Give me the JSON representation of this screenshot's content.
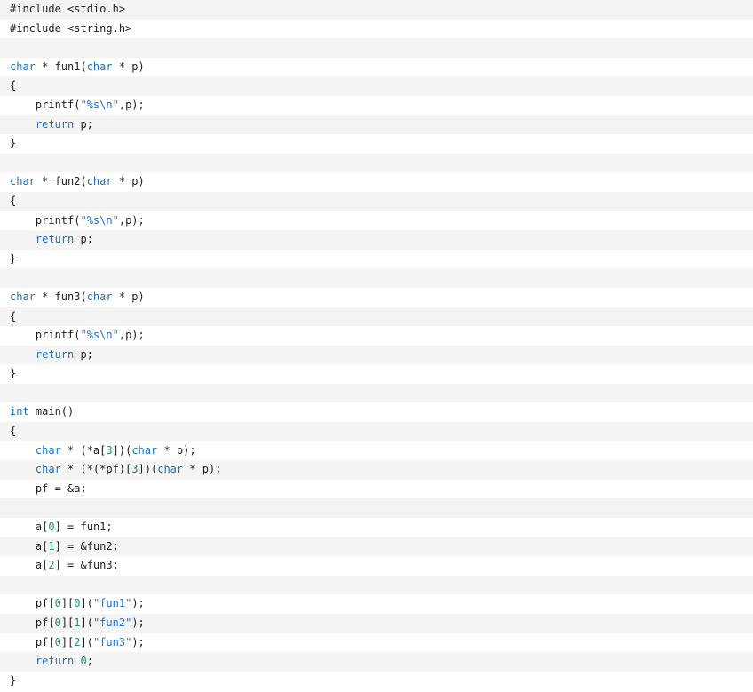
{
  "colors": {
    "keyword": "#1a73c8",
    "string": "#1a6fd0",
    "number": "#1b8f6a",
    "text": "#1f1f1f",
    "stripe": "#f4f4f4",
    "background": "#ffffff"
  },
  "lines": [
    {
      "shade": true,
      "tokens": [
        {
          "t": "#include <stdio.h>",
          "c": "tx"
        }
      ]
    },
    {
      "shade": false,
      "tokens": [
        {
          "t": "#include <string.h>",
          "c": "tx"
        }
      ]
    },
    {
      "shade": true,
      "tokens": []
    },
    {
      "shade": false,
      "tokens": [
        {
          "t": "char",
          "c": "kw"
        },
        {
          "t": " * fun1(",
          "c": "tx"
        },
        {
          "t": "char",
          "c": "kw"
        },
        {
          "t": " * p)",
          "c": "tx"
        }
      ]
    },
    {
      "shade": true,
      "tokens": [
        {
          "t": "{",
          "c": "tx"
        }
      ]
    },
    {
      "shade": false,
      "tokens": [
        {
          "t": "    printf(",
          "c": "tx"
        },
        {
          "t": "\"%s\\n\"",
          "c": "str"
        },
        {
          "t": ",p);",
          "c": "tx"
        }
      ]
    },
    {
      "shade": true,
      "tokens": [
        {
          "t": "    ",
          "c": "tx"
        },
        {
          "t": "return",
          "c": "kw"
        },
        {
          "t": " p;",
          "c": "tx"
        }
      ]
    },
    {
      "shade": false,
      "tokens": [
        {
          "t": "}",
          "c": "tx"
        }
      ]
    },
    {
      "shade": true,
      "tokens": []
    },
    {
      "shade": false,
      "tokens": [
        {
          "t": "char",
          "c": "kw"
        },
        {
          "t": " * fun2(",
          "c": "tx"
        },
        {
          "t": "char",
          "c": "kw"
        },
        {
          "t": " * p)",
          "c": "tx"
        }
      ]
    },
    {
      "shade": true,
      "tokens": [
        {
          "t": "{",
          "c": "tx"
        }
      ]
    },
    {
      "shade": false,
      "tokens": [
        {
          "t": "    printf(",
          "c": "tx"
        },
        {
          "t": "\"%s\\n\"",
          "c": "str"
        },
        {
          "t": ",p);",
          "c": "tx"
        }
      ]
    },
    {
      "shade": true,
      "tokens": [
        {
          "t": "    ",
          "c": "tx"
        },
        {
          "t": "return",
          "c": "kw"
        },
        {
          "t": " p;",
          "c": "tx"
        }
      ]
    },
    {
      "shade": false,
      "tokens": [
        {
          "t": "}",
          "c": "tx"
        }
      ]
    },
    {
      "shade": true,
      "tokens": []
    },
    {
      "shade": false,
      "tokens": [
        {
          "t": "char",
          "c": "kw"
        },
        {
          "t": " * fun3(",
          "c": "tx"
        },
        {
          "t": "char",
          "c": "kw"
        },
        {
          "t": " * p)",
          "c": "tx"
        }
      ]
    },
    {
      "shade": true,
      "tokens": [
        {
          "t": "{",
          "c": "tx"
        }
      ]
    },
    {
      "shade": false,
      "tokens": [
        {
          "t": "    printf(",
          "c": "tx"
        },
        {
          "t": "\"%s\\n\"",
          "c": "str"
        },
        {
          "t": ",p);",
          "c": "tx"
        }
      ]
    },
    {
      "shade": true,
      "tokens": [
        {
          "t": "    ",
          "c": "tx"
        },
        {
          "t": "return",
          "c": "kw"
        },
        {
          "t": " p;",
          "c": "tx"
        }
      ]
    },
    {
      "shade": false,
      "tokens": [
        {
          "t": "}",
          "c": "tx"
        }
      ]
    },
    {
      "shade": true,
      "tokens": []
    },
    {
      "shade": false,
      "tokens": [
        {
          "t": "int",
          "c": "kw"
        },
        {
          "t": " main()",
          "c": "tx"
        }
      ]
    },
    {
      "shade": true,
      "tokens": [
        {
          "t": "{",
          "c": "tx"
        }
      ]
    },
    {
      "shade": false,
      "tokens": [
        {
          "t": "    ",
          "c": "tx"
        },
        {
          "t": "char",
          "c": "kw"
        },
        {
          "t": " * (*a[",
          "c": "tx"
        },
        {
          "t": "3",
          "c": "num"
        },
        {
          "t": "])(",
          "c": "tx"
        },
        {
          "t": "char",
          "c": "kw"
        },
        {
          "t": " * p);",
          "c": "tx"
        }
      ]
    },
    {
      "shade": true,
      "tokens": [
        {
          "t": "    ",
          "c": "tx"
        },
        {
          "t": "char",
          "c": "kw"
        },
        {
          "t": " * (*(*pf)[",
          "c": "tx"
        },
        {
          "t": "3",
          "c": "num"
        },
        {
          "t": "])(",
          "c": "tx"
        },
        {
          "t": "char",
          "c": "kw"
        },
        {
          "t": " * p);",
          "c": "tx"
        }
      ]
    },
    {
      "shade": false,
      "tokens": [
        {
          "t": "    pf = &a;",
          "c": "tx"
        }
      ]
    },
    {
      "shade": true,
      "tokens": []
    },
    {
      "shade": false,
      "tokens": [
        {
          "t": "    a[",
          "c": "tx"
        },
        {
          "t": "0",
          "c": "num"
        },
        {
          "t": "] = fun1;",
          "c": "tx"
        }
      ]
    },
    {
      "shade": true,
      "tokens": [
        {
          "t": "    a[",
          "c": "tx"
        },
        {
          "t": "1",
          "c": "num"
        },
        {
          "t": "] = &fun2;",
          "c": "tx"
        }
      ]
    },
    {
      "shade": false,
      "tokens": [
        {
          "t": "    a[",
          "c": "tx"
        },
        {
          "t": "2",
          "c": "num"
        },
        {
          "t": "] = &fun3;",
          "c": "tx"
        }
      ]
    },
    {
      "shade": true,
      "tokens": []
    },
    {
      "shade": false,
      "tokens": [
        {
          "t": "    pf[",
          "c": "tx"
        },
        {
          "t": "0",
          "c": "num"
        },
        {
          "t": "][",
          "c": "tx"
        },
        {
          "t": "0",
          "c": "num"
        },
        {
          "t": "](",
          "c": "tx"
        },
        {
          "t": "\"fun1\"",
          "c": "str"
        },
        {
          "t": ");",
          "c": "tx"
        }
      ]
    },
    {
      "shade": true,
      "tokens": [
        {
          "t": "    pf[",
          "c": "tx"
        },
        {
          "t": "0",
          "c": "num"
        },
        {
          "t": "][",
          "c": "tx"
        },
        {
          "t": "1",
          "c": "num"
        },
        {
          "t": "](",
          "c": "tx"
        },
        {
          "t": "\"fun2\"",
          "c": "str"
        },
        {
          "t": ");",
          "c": "tx"
        }
      ]
    },
    {
      "shade": false,
      "tokens": [
        {
          "t": "    pf[",
          "c": "tx"
        },
        {
          "t": "0",
          "c": "num"
        },
        {
          "t": "][",
          "c": "tx"
        },
        {
          "t": "2",
          "c": "num"
        },
        {
          "t": "](",
          "c": "tx"
        },
        {
          "t": "\"fun3\"",
          "c": "str"
        },
        {
          "t": ");",
          "c": "tx"
        }
      ]
    },
    {
      "shade": true,
      "tokens": [
        {
          "t": "    ",
          "c": "tx"
        },
        {
          "t": "return",
          "c": "kw"
        },
        {
          "t": " ",
          "c": "tx"
        },
        {
          "t": "0",
          "c": "num"
        },
        {
          "t": ";",
          "c": "tx"
        }
      ]
    },
    {
      "shade": false,
      "tokens": [
        {
          "t": "}",
          "c": "tx"
        }
      ]
    }
  ]
}
